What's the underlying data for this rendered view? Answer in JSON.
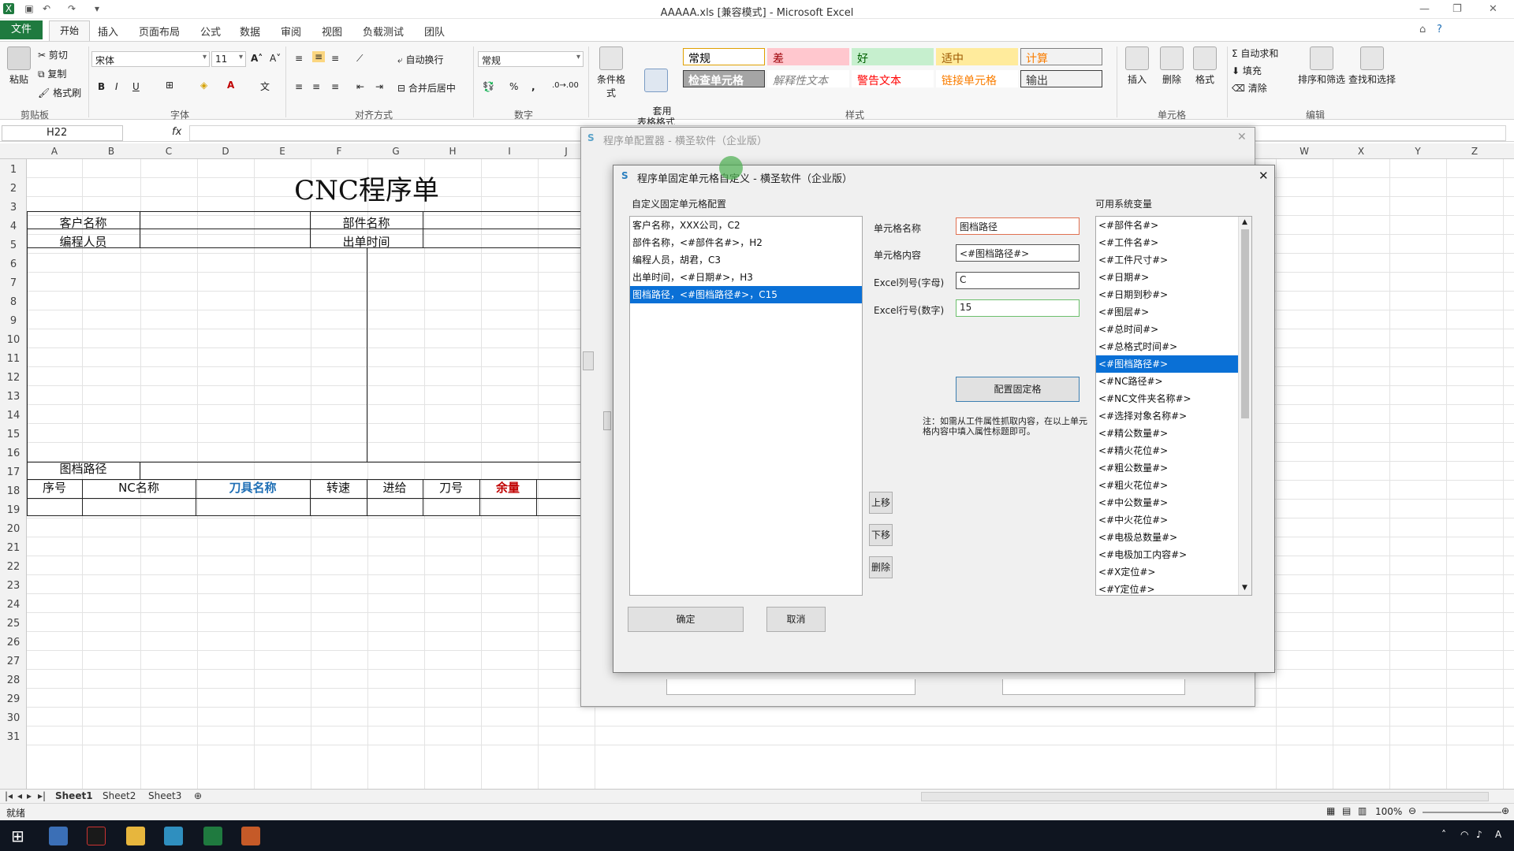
{
  "window": {
    "title": "AAAAA.xls  [兼容模式] - Microsoft Excel"
  },
  "ribbon": {
    "tabs": [
      "文件",
      "开始",
      "插入",
      "页面布局",
      "公式",
      "数据",
      "审阅",
      "视图",
      "负载测试",
      "团队"
    ],
    "clipboard": {
      "paste": "粘贴",
      "cut": "剪切",
      "copy": "复制",
      "format_painter": "格式刷",
      "group": "剪贴板"
    },
    "font": {
      "name": "宋体",
      "size": "11",
      "group": "字体"
    },
    "alignment": {
      "wrap": "自动换行",
      "merge": "合并后居中",
      "group": "对齐方式"
    },
    "number": {
      "format": "常规",
      "percent": "%",
      "comma": ",",
      "group": "数字"
    },
    "styles": {
      "conditional": "条件格式",
      "table_format": "套用\n表格格式",
      "group": "样式",
      "cells": [
        {
          "label": "常规",
          "bg": "#ffffff",
          "fg": "#000000",
          "border": "#e0a000"
        },
        {
          "label": "差",
          "bg": "#ffc7ce",
          "fg": "#9c0006",
          "border": "#ffc7ce"
        },
        {
          "label": "好",
          "bg": "#c6efce",
          "fg": "#006100",
          "border": "#c6efce"
        },
        {
          "label": "适中",
          "bg": "#ffeb9c",
          "fg": "#9c5700",
          "border": "#ffeb9c"
        },
        {
          "label": "计算",
          "bg": "#f2f2f2",
          "fg": "#fa7d00",
          "border": "#7f7f7f"
        },
        {
          "label": "检查单元格",
          "bg": "#a5a5a5",
          "fg": "#ffffff",
          "border": "#3f3f3f"
        },
        {
          "label": "解释性文本",
          "bg": "#ffffff",
          "fg": "#7f7f7f",
          "border": "#ffffff"
        },
        {
          "label": "警告文本",
          "bg": "#ffffff",
          "fg": "#ff0000",
          "border": "#ffffff"
        },
        {
          "label": "链接单元格",
          "bg": "#ffffff",
          "fg": "#fa7d00",
          "border": "#ffffff"
        },
        {
          "label": "输出",
          "bg": "#f2f2f2",
          "fg": "#3f3f3f",
          "border": "#3f3f3f"
        }
      ]
    },
    "cells": {
      "insert": "插入",
      "delete": "删除",
      "format": "格式",
      "group": "单元格"
    },
    "editing": {
      "autosum": "自动求和",
      "fill": "填充",
      "clear": "清除",
      "sort": "排序和筛选",
      "find": "查找和选择",
      "group": "编辑"
    }
  },
  "formula_bar": {
    "name_box": "H22",
    "fx": "fx"
  },
  "sheet": {
    "columns_left": [
      "A",
      "B",
      "C",
      "D",
      "E",
      "F",
      "G",
      "H",
      "I",
      "J"
    ],
    "columns_right": [
      "W",
      "X",
      "Y",
      "Z"
    ],
    "rows": [
      "1",
      "2",
      "3",
      "4",
      "5",
      "6",
      "7",
      "8",
      "9",
      "10",
      "11",
      "12",
      "13",
      "14",
      "15",
      "16",
      "17",
      "18",
      "19",
      "20",
      "21",
      "22",
      "23",
      "24",
      "25",
      "26",
      "27",
      "28",
      "29",
      "30",
      "31"
    ],
    "title": "CNC程序单",
    "customer_label": "客户名称",
    "part_label": "部件名称",
    "programmer_label": "编程人员",
    "date_label": "出单时间",
    "path_label": "图档路径",
    "table_headers": [
      {
        "label": "序号",
        "color": "#111111"
      },
      {
        "label": "NC名称",
        "color": "#111111"
      },
      {
        "label": "刀具名称",
        "color": "#1f6fb5"
      },
      {
        "label": "转速",
        "color": "#111111"
      },
      {
        "label": "进给",
        "color": "#111111"
      },
      {
        "label": "刀号",
        "color": "#111111"
      },
      {
        "label": "余量",
        "color": "#c00000"
      }
    ]
  },
  "sheet_tabs": [
    "Sheet1",
    "Sheet2",
    "Sheet3"
  ],
  "status": {
    "ready": "就绪",
    "zoom": "100%"
  },
  "back_dialog": {
    "title": "程序单配置器 - 横圣软件（企业版）"
  },
  "dialog": {
    "title": "程序单固定单元格自定义 - 横圣软件（企业版）",
    "left_header": "自定义固定单元格配置",
    "items": [
      "客户名称，XXX公司，C2",
      "部件名称，<#部件名#>，H2",
      "编程人员，胡君，C3",
      "出单时间，<#日期#>，H3",
      "图档路径，<#图档路径#>，C15"
    ],
    "selected_index": 4,
    "field_name_label": "单元格名称",
    "field_name_value": "图档路径",
    "field_content_label": "单元格内容",
    "field_content_value": "<#图档路径#>",
    "field_col_label": "Excel列号(字母)",
    "field_col_value": "C",
    "field_row_label": "Excel行号(数字)",
    "field_row_value": "15",
    "config_button": "配置固定格",
    "note": "注：如需从工件属性抓取内容，在以上单元格内容中填入属性标题即可。",
    "up_button": "上移",
    "down_button": "下移",
    "delete_button": "删除",
    "ok_button": "确定",
    "cancel_button": "取消",
    "vars_header": "可用系统变量",
    "vars": [
      "<#部件名#>",
      "<#工件名#>",
      "<#工件尺寸#>",
      "<#日期#>",
      "<#日期到秒#>",
      "<#图层#>",
      "<#总时间#>",
      "<#总格式时间#>",
      "<#图档路径#>",
      "<#NC路径#>",
      "<#NC文件夹名称#>",
      "<#选择对象名称#>",
      "<#精公数量#>",
      "<#精火花位#>",
      "<#粗公数量#>",
      "<#粗火花位#>",
      "<#中公数量#>",
      "<#中火花位#>",
      "<#电极总数量#>",
      "<#电极加工内容#>",
      "<#X定位#>",
      "<#Y定位#>"
    ],
    "vars_selected_index": 8
  }
}
